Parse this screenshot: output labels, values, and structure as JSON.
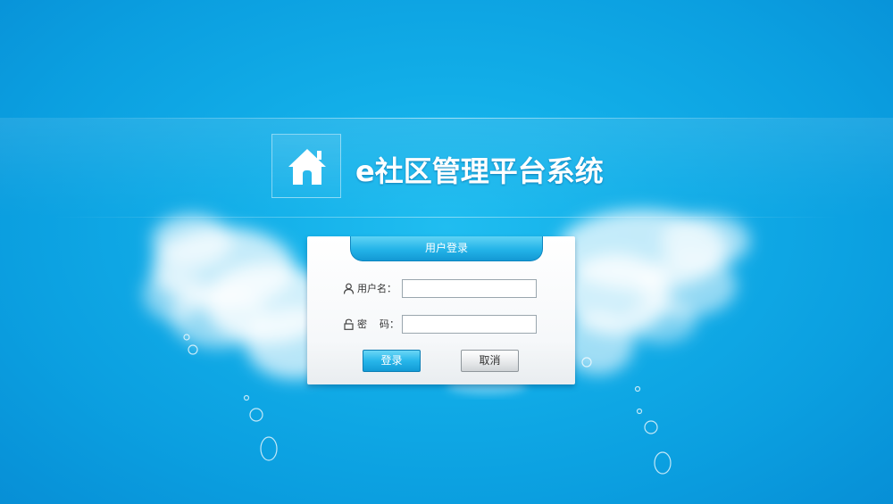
{
  "app": {
    "title": "e社区管理平台系统",
    "logo_icon": "house-icon"
  },
  "login": {
    "panel_title": "用户登录",
    "username_label": "用户名：",
    "username_icon": "user-icon",
    "username_value": "",
    "password_label": "密    码：",
    "password_icon": "lock-icon",
    "password_value": "",
    "login_button": "登录",
    "cancel_button": "取消"
  },
  "colors": {
    "background": "#12aee8",
    "panel_tab": "#23b3e8",
    "login_button": "#27b6ea",
    "cancel_button": "#e6e8ea"
  }
}
